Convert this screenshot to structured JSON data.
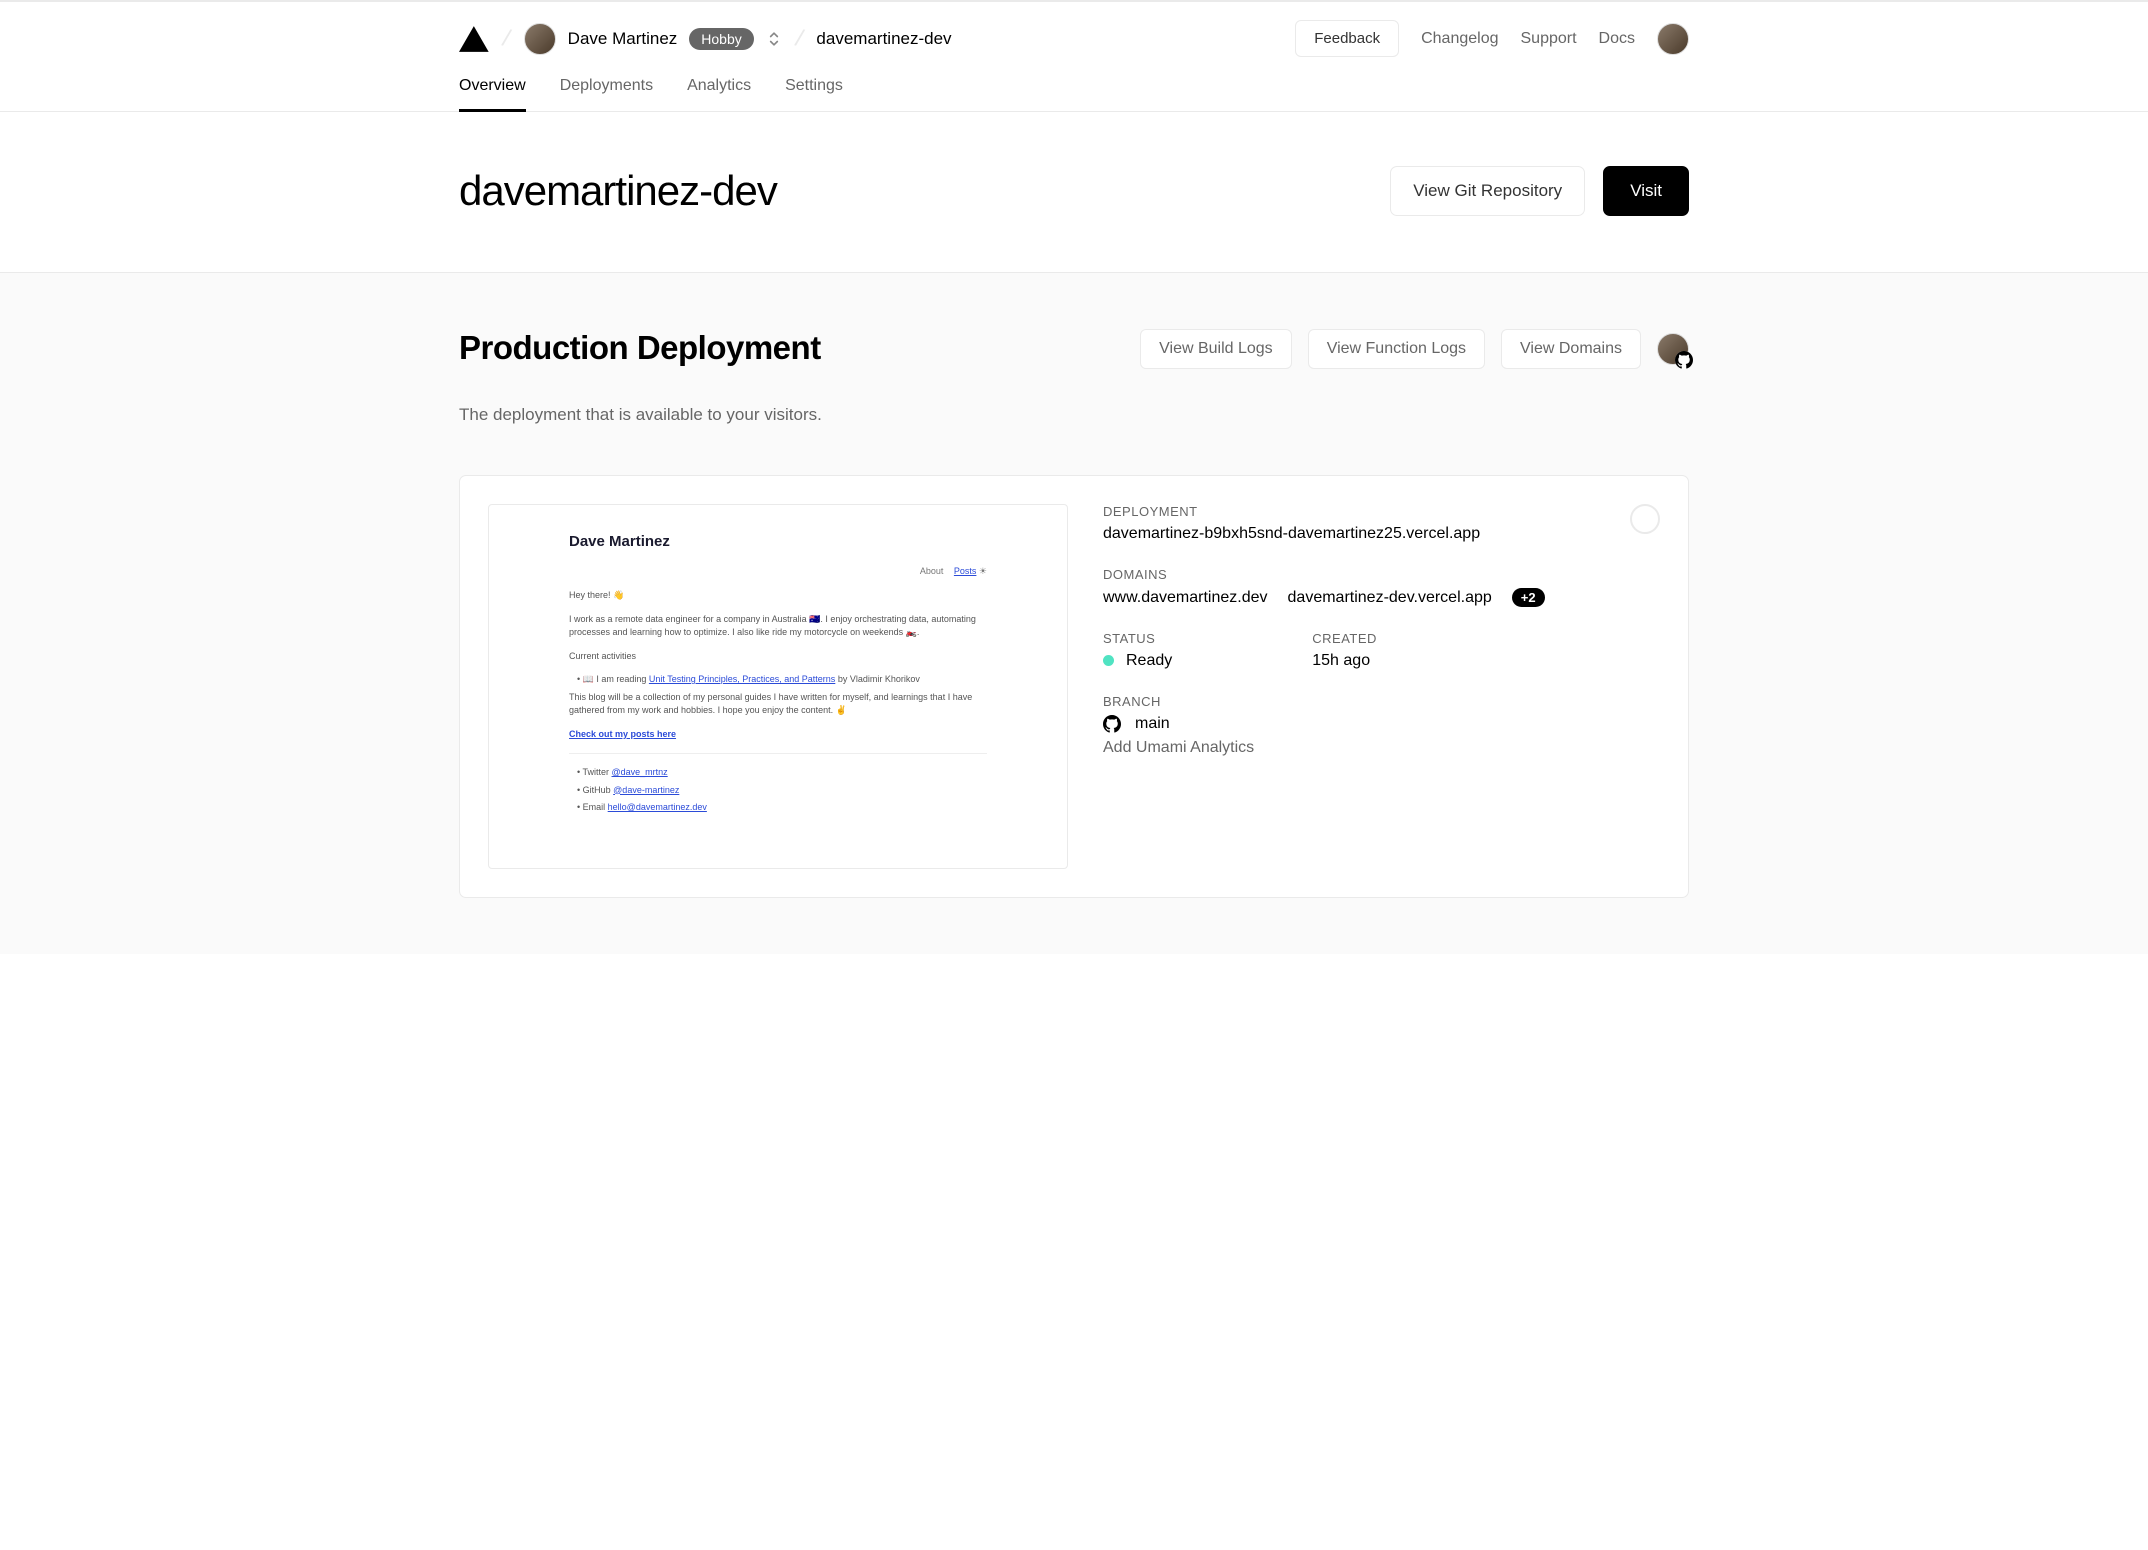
{
  "header": {
    "user_name": "Dave Martinez",
    "plan_badge": "Hobby",
    "project_crumb": "davemartinez-dev",
    "feedback": "Feedback",
    "changelog": "Changelog",
    "support": "Support",
    "docs": "Docs"
  },
  "tabs": {
    "overview": "Overview",
    "deployments": "Deployments",
    "analytics": "Analytics",
    "settings": "Settings"
  },
  "hero": {
    "title": "davemartinez-dev",
    "view_git": "View Git Repository",
    "visit": "Visit"
  },
  "production": {
    "heading": "Production Deployment",
    "subtitle": "The deployment that is available to your visitors.",
    "view_build_logs": "View Build Logs",
    "view_function_logs": "View Function Logs",
    "view_domains": "View Domains"
  },
  "deployment": {
    "label_deployment": "DEPLOYMENT",
    "url": "davemartinez-b9bxh5snd-davemartinez25.vercel.app",
    "label_domains": "DOMAINS",
    "domain_primary": "www.davemartinez.dev",
    "domain_secondary": "davemartinez-dev.vercel.app",
    "domain_extra_count": "+2",
    "label_status": "STATUS",
    "status_value": "Ready",
    "label_created": "CREATED",
    "created_value": "15h ago",
    "label_branch": "BRANCH",
    "branch_name": "main",
    "commit_message": "Add Umami Analytics"
  },
  "preview": {
    "name": "Dave Martinez",
    "about": "About",
    "posts": "Posts",
    "hey": "Hey there! 👋",
    "intro": "I work as a remote data engineer for a company in Australia 🇦🇺. I enjoy orchestrating data, automating processes and learning how to optimize. I also like ride my motorcycle on weekends 🏍️.",
    "current": "Current activities",
    "reading_prefix": "📖 I am reading ",
    "reading_link": "Unit Testing Principles, Practices, and Patterns",
    "reading_suffix": " by Vladimir Khorikov",
    "blog": "This blog will be a collection of my personal guides I have written for myself, and learnings that I have gathered from my work and hobbies. I hope you enjoy the content. ✌️",
    "checkout": "Check out my posts here",
    "twitter_label": "Twitter ",
    "twitter_handle": "@dave_mrtnz",
    "github_label": "GitHub ",
    "github_handle": "@dave-martinez",
    "email_label": "Email ",
    "email_value": "hello@davemartinez.dev"
  }
}
